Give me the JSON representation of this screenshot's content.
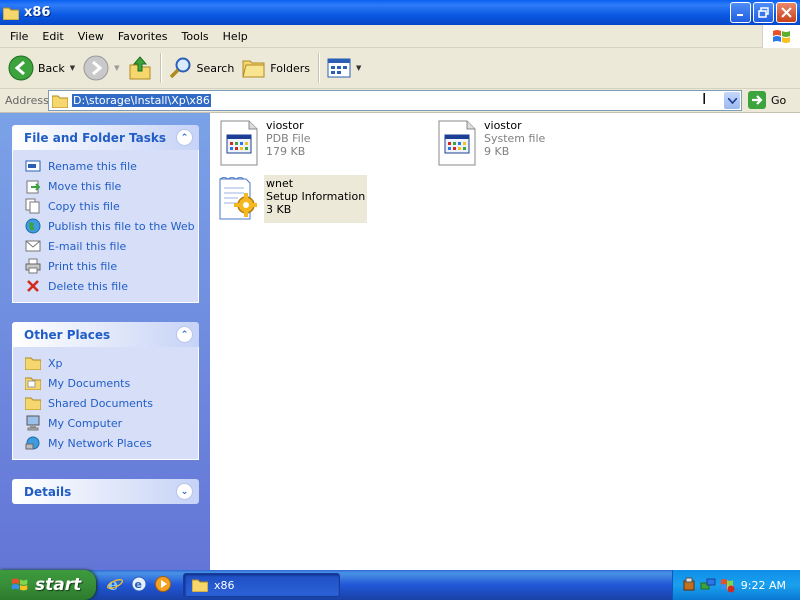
{
  "window": {
    "title": "x86"
  },
  "menu": {
    "items": [
      "File",
      "Edit",
      "View",
      "Favorites",
      "Tools",
      "Help"
    ]
  },
  "toolbar": {
    "back_label": "Back",
    "search_label": "Search",
    "folders_label": "Folders"
  },
  "address": {
    "label": "Address",
    "value": "D:\\storage\\Install\\Xp\\x86",
    "go_label": "Go"
  },
  "file_tasks": {
    "title": "File and Folder Tasks",
    "items": [
      {
        "label": "Rename this file",
        "icon": "rename-icon"
      },
      {
        "label": "Move this file",
        "icon": "move-icon"
      },
      {
        "label": "Copy this file",
        "icon": "copy-icon"
      },
      {
        "label": "Publish this file to the Web",
        "icon": "globe-icon"
      },
      {
        "label": "E-mail this file",
        "icon": "email-icon"
      },
      {
        "label": "Print this file",
        "icon": "printer-icon"
      },
      {
        "label": "Delete this file",
        "icon": "delete-icon"
      }
    ]
  },
  "other_places": {
    "title": "Other Places",
    "items": [
      {
        "label": "Xp",
        "icon": "folder-icon"
      },
      {
        "label": "My Documents",
        "icon": "folder-icon"
      },
      {
        "label": "Shared Documents",
        "icon": "folder-icon"
      },
      {
        "label": "My Computer",
        "icon": "computer-icon"
      },
      {
        "label": "My Network Places",
        "icon": "network-icon"
      }
    ]
  },
  "details": {
    "title": "Details"
  },
  "files": [
    {
      "name": "viostor",
      "type": "PDB File",
      "size": "179 KB"
    },
    {
      "name": "viostor",
      "type": "System file",
      "size": "9 KB"
    },
    {
      "name": "wnet",
      "type": "Setup Information",
      "size": "3 KB"
    }
  ],
  "taskbar": {
    "start_label": "start",
    "task_label": "x86",
    "clock": "9:22 AM"
  },
  "colors": {
    "link": "#215dc6",
    "selection": "#316ac5",
    "taskbar": "#2157d7",
    "start": "#388e38"
  }
}
